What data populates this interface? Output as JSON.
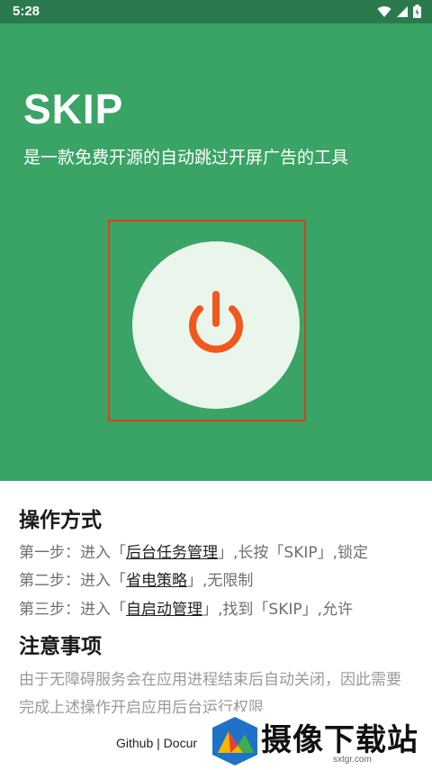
{
  "status_bar": {
    "time": "5:28",
    "icons": [
      "wifi-icon",
      "signal-icon",
      "battery-icon"
    ]
  },
  "hero": {
    "app_name": "SKIP",
    "tagline": "是一款免费开源的自动跳过开屏广告的工具",
    "power_button": "power-icon",
    "background_color": "#39a465",
    "accent_color": "#f2571d"
  },
  "instructions": {
    "title": "操作方式",
    "steps": [
      {
        "prefix": "第一步：进入「",
        "link": "后台任务管理",
        "suffix": "」,长按「SKIP」,锁定"
      },
      {
        "prefix": "第二步：进入「",
        "link": "省电策略",
        "suffix": "」,无限制"
      },
      {
        "prefix": "第三步：进入「",
        "link": "自启动管理",
        "suffix": "」,找到「SKIP」,允许"
      }
    ]
  },
  "notes": {
    "title": "注意事项",
    "text": "由于无障碍服务会在应用进程结束后自动关闭，因此需要完成上述操作开启应用后台运行权限"
  },
  "footer": {
    "github": "Github",
    "separator": "|",
    "docs": "Docur"
  },
  "watermark": {
    "text": "摄像下载站",
    "site": "sxtgr.com"
  }
}
